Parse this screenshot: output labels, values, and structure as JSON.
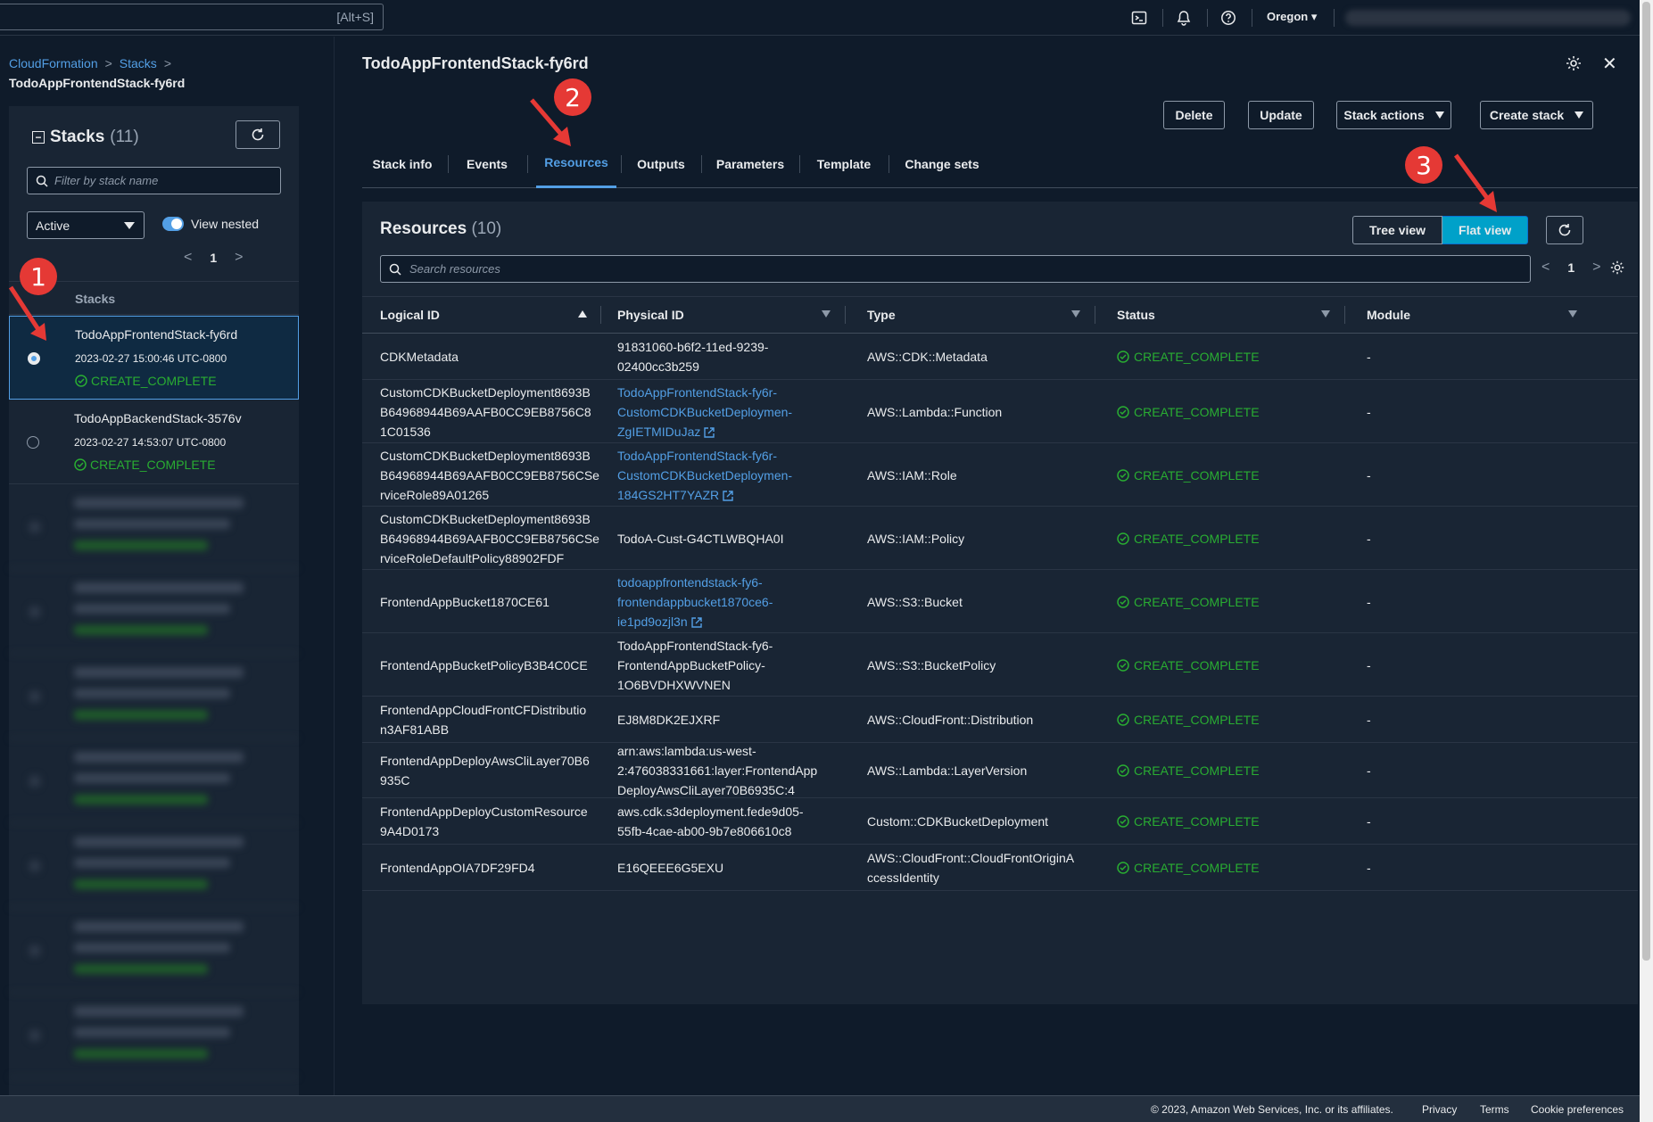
{
  "topbar": {
    "search_shortcut": "[Alt+S]",
    "region": "Oregon",
    "icons": [
      "cloudshell-icon",
      "notifications-icon",
      "help-icon"
    ]
  },
  "breadcrumb": {
    "items": [
      "CloudFormation",
      "Stacks"
    ],
    "current": "TodoAppFrontendStack-fy6rd"
  },
  "stacks_panel": {
    "title": "Stacks",
    "count": "(11)",
    "filter_placeholder": "Filter by stack name",
    "status_filter": "Active",
    "view_nested_label": "View nested",
    "view_nested_enabled": true,
    "page": "1",
    "column_header": "Stacks",
    "rows": [
      {
        "name": "TodoAppFrontendStack-fy6rd",
        "date": "2023-02-27 15:00:46 UTC-0800",
        "status": "CREATE_COMPLETE",
        "selected": true
      },
      {
        "name": "TodoAppBackendStack-3576v",
        "date": "2023-02-27 14:53:07 UTC-0800",
        "status": "CREATE_COMPLETE",
        "selected": false
      }
    ]
  },
  "stack_detail": {
    "title": "TodoAppFrontendStack-fy6rd",
    "actions": {
      "delete": "Delete",
      "update": "Update",
      "stack_actions": "Stack actions",
      "create_stack": "Create stack"
    },
    "tabs": [
      "Stack info",
      "Events",
      "Resources",
      "Outputs",
      "Parameters",
      "Template",
      "Change sets"
    ],
    "active_tab": "Resources"
  },
  "resources": {
    "title": "Resources",
    "count": "(10)",
    "tree_view_label": "Tree view",
    "flat_view_label": "Flat view",
    "active_view": "Flat view",
    "search_placeholder": "Search resources",
    "page": "1",
    "columns": [
      "Logical ID",
      "Physical ID",
      "Type",
      "Status",
      "Module"
    ],
    "rows": [
      {
        "logical": [
          "CDKMetadata"
        ],
        "physical": [
          "91831060-b6f2-11ed-9239-",
          "02400cc3b259"
        ],
        "physical_link": false,
        "type": [
          "AWS::CDK::Metadata"
        ],
        "status": "CREATE_COMPLETE",
        "module": "-"
      },
      {
        "logical": [
          "CustomCDKBucketDeployment8693B",
          "B64968944B69AAFB0CC9EB8756C8",
          "1C01536"
        ],
        "physical": [
          "TodoAppFrontendStack-fy6r-",
          "CustomCDKBucketDeploymen-",
          "ZgIETMIDuJaz"
        ],
        "physical_link": true,
        "type": [
          "AWS::Lambda::Function"
        ],
        "status": "CREATE_COMPLETE",
        "module": "-"
      },
      {
        "logical": [
          "CustomCDKBucketDeployment8693B",
          "B64968944B69AAFB0CC9EB8756CSe",
          "rviceRole89A01265"
        ],
        "physical": [
          "TodoAppFrontendStack-fy6r-",
          "CustomCDKBucketDeploymen-",
          "184GS2HT7YAZR"
        ],
        "physical_link": true,
        "type": [
          "AWS::IAM::Role"
        ],
        "status": "CREATE_COMPLETE",
        "module": "-"
      },
      {
        "logical": [
          "CustomCDKBucketDeployment8693B",
          "B64968944B69AAFB0CC9EB8756CSe",
          "rviceRoleDefaultPolicy88902FDF"
        ],
        "physical": [
          "TodoA-Cust-G4CTLWBQHA0I"
        ],
        "physical_link": false,
        "type": [
          "AWS::IAM::Policy"
        ],
        "status": "CREATE_COMPLETE",
        "module": "-"
      },
      {
        "logical": [
          "FrontendAppBucket1870CE61"
        ],
        "physical": [
          "todoappfrontendstack-fy6-",
          "frontendappbucket1870ce6-",
          "ie1pd9ozjl3n"
        ],
        "physical_link": true,
        "type": [
          "AWS::S3::Bucket"
        ],
        "status": "CREATE_COMPLETE",
        "module": "-"
      },
      {
        "logical": [
          "FrontendAppBucketPolicyB3B4C0CE"
        ],
        "physical": [
          "TodoAppFrontendStack-fy6-",
          "FrontendAppBucketPolicy-",
          "1O6BVDHXWVNEN"
        ],
        "physical_link": false,
        "type": [
          "AWS::S3::BucketPolicy"
        ],
        "status": "CREATE_COMPLETE",
        "module": "-"
      },
      {
        "logical": [
          "FrontendAppCloudFrontCFDistributio",
          "n3AF81ABB"
        ],
        "physical": [
          "EJ8M8DK2EJXRF"
        ],
        "physical_link": false,
        "type": [
          "AWS::CloudFront::Distribution"
        ],
        "status": "CREATE_COMPLETE",
        "module": "-"
      },
      {
        "logical": [
          "FrontendAppDeployAwsCliLayer70B6",
          "935C"
        ],
        "physical": [
          "arn:aws:lambda:us-west-",
          "2:476038331661:layer:FrontendApp",
          "DeployAwsCliLayer70B6935C:4"
        ],
        "physical_link": false,
        "type": [
          "AWS::Lambda::LayerVersion"
        ],
        "status": "CREATE_COMPLETE",
        "module": "-"
      },
      {
        "logical": [
          "FrontendAppDeployCustomResource",
          "9A4D0173"
        ],
        "physical": [
          "aws.cdk.s3deployment.fede9d05-",
          "55fb-4cae-ab00-9b7e806610c8"
        ],
        "physical_link": false,
        "type": [
          "Custom::CDKBucketDeployment"
        ],
        "status": "CREATE_COMPLETE",
        "module": "-"
      },
      {
        "logical": [
          "FrontendAppOIA7DF29FD4"
        ],
        "physical": [
          "E16QEEE6G5EXU"
        ],
        "physical_link": false,
        "type": [
          "AWS::CloudFront::CloudFrontOriginA",
          "ccessIdentity"
        ],
        "status": "CREATE_COMPLETE",
        "module": "-"
      }
    ]
  },
  "annotations": [
    "1",
    "2",
    "3"
  ],
  "footer": {
    "copyright": "© 2023, Amazon Web Services, Inc. or its affiliates.",
    "privacy": "Privacy",
    "terms": "Terms",
    "cookies": "Cookie preferences"
  },
  "colors": {
    "accent": "#539fe5",
    "success": "#29ad32",
    "annotation": "#e53935",
    "active_toggle": "#00a1c9"
  }
}
